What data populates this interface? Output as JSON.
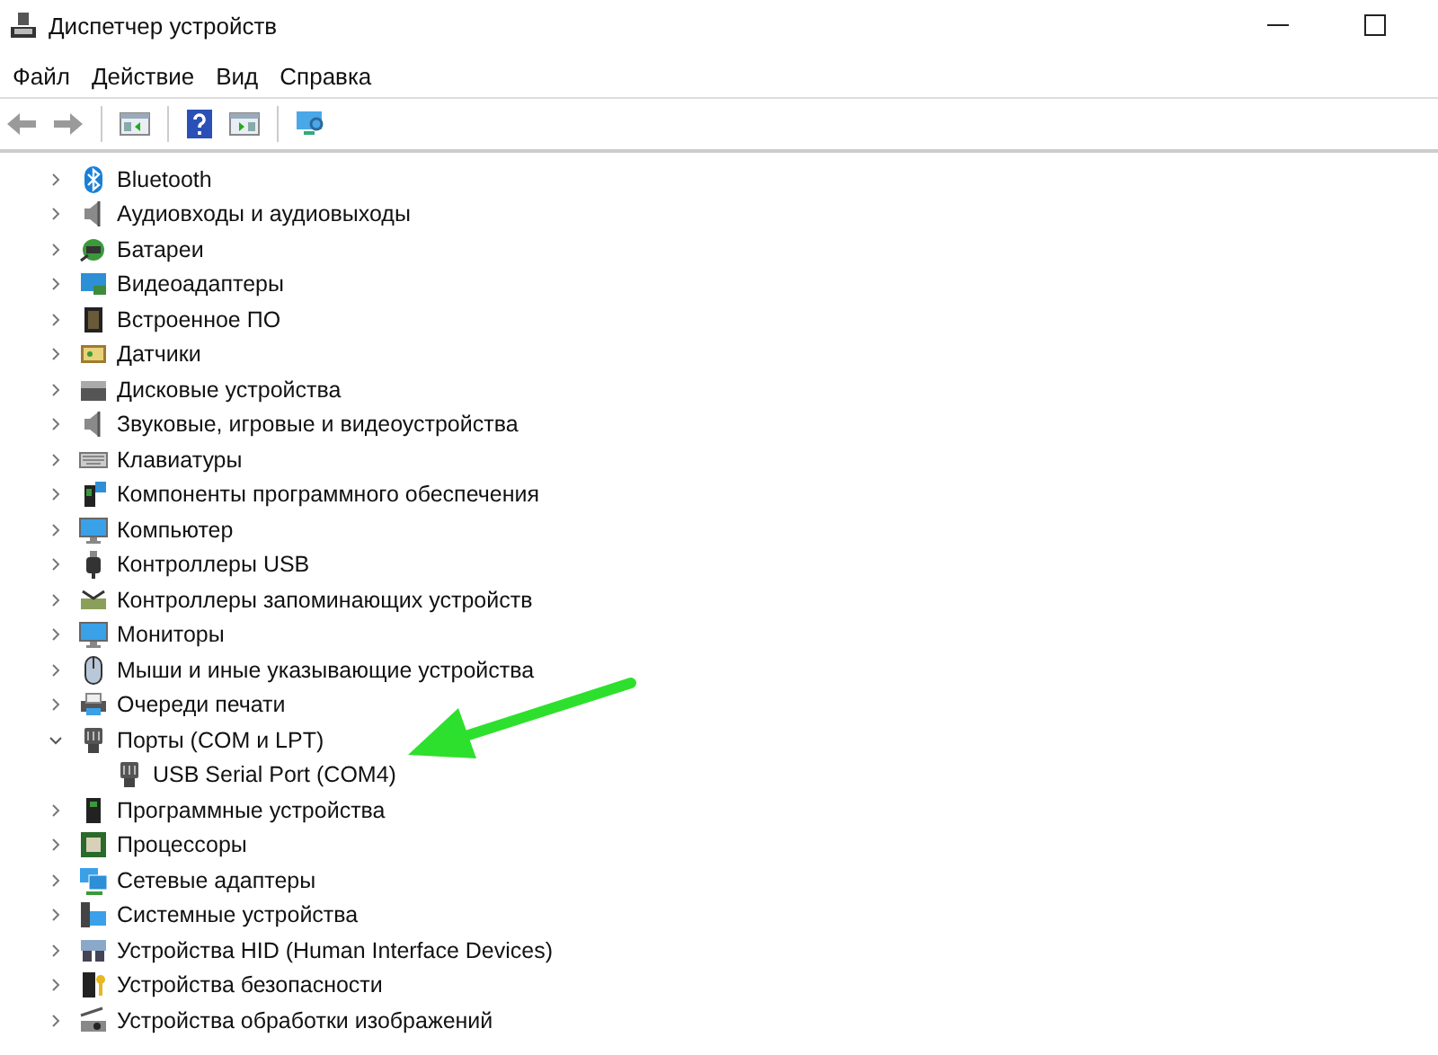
{
  "window": {
    "title": "Диспетчер устройств"
  },
  "menu": [
    "Файл",
    "Действие",
    "Вид",
    "Справка"
  ],
  "tree": [
    {
      "label": "Bluetooth",
      "expanded": false
    },
    {
      "label": "Аудиовходы и аудиовыходы",
      "expanded": false
    },
    {
      "label": "Батареи",
      "expanded": false
    },
    {
      "label": "Видеоадаптеры",
      "expanded": false
    },
    {
      "label": "Встроенное ПО",
      "expanded": false
    },
    {
      "label": "Датчики",
      "expanded": false
    },
    {
      "label": "Дисковые устройства",
      "expanded": false
    },
    {
      "label": "Звуковые, игровые и видеоустройства",
      "expanded": false
    },
    {
      "label": "Клавиатуры",
      "expanded": false
    },
    {
      "label": "Компоненты программного обеспечения",
      "expanded": false
    },
    {
      "label": "Компьютер",
      "expanded": false
    },
    {
      "label": "Контроллеры USB",
      "expanded": false
    },
    {
      "label": "Контроллеры запоминающих устройств",
      "expanded": false
    },
    {
      "label": "Мониторы",
      "expanded": false
    },
    {
      "label": "Мыши и иные указывающие устройства",
      "expanded": false
    },
    {
      "label": "Очереди печати",
      "expanded": false
    },
    {
      "label": "Порты (COM и LPT)",
      "expanded": true,
      "children": [
        {
          "label": "USB Serial Port (COM4)"
        }
      ]
    },
    {
      "label": "Программные устройства",
      "expanded": false
    },
    {
      "label": "Процессоры",
      "expanded": false
    },
    {
      "label": "Сетевые адаптеры",
      "expanded": false
    },
    {
      "label": "Системные устройства",
      "expanded": false
    },
    {
      "label": "Устройства HID (Human Interface Devices)",
      "expanded": false
    },
    {
      "label": "Устройства безопасности",
      "expanded": false
    },
    {
      "label": "Устройства обработки изображений",
      "expanded": false
    }
  ]
}
